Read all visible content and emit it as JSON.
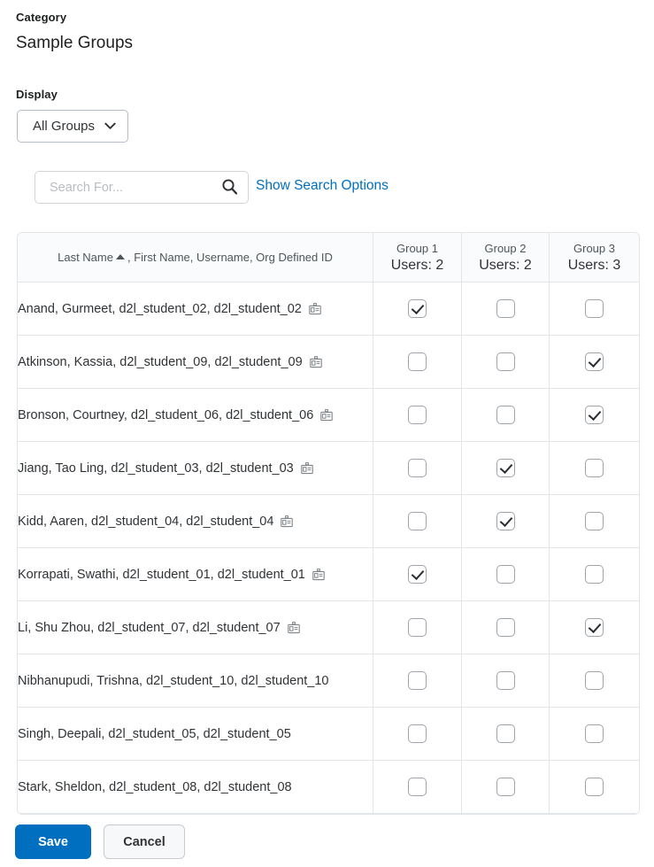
{
  "form": {
    "category_label": "Category",
    "category_value": "Sample Groups",
    "display_label": "Display",
    "display_selected": "All Groups"
  },
  "search": {
    "placeholder": "Search For...",
    "value": "",
    "search_icon": "search-icon",
    "show_options_link": "Show Search Options"
  },
  "table": {
    "name_column": {
      "sort_field": "Last Name",
      "sort_direction": "ascending",
      "rest": ", First Name, Username, Org Defined ID"
    },
    "groups": [
      {
        "name": "Group 1",
        "users": "Users: 2"
      },
      {
        "name": "Group 2",
        "users": "Users: 2"
      },
      {
        "name": "Group 3",
        "users": "Users: 3"
      }
    ],
    "rows": [
      {
        "label": "Anand, Gurmeet, d2l_student_02, d2l_student_02",
        "badge": true,
        "checks": [
          true,
          false,
          false
        ]
      },
      {
        "label": "Atkinson, Kassia, d2l_student_09, d2l_student_09",
        "badge": true,
        "checks": [
          false,
          false,
          true
        ]
      },
      {
        "label": "Bronson, Courtney, d2l_student_06, d2l_student_06",
        "badge": true,
        "checks": [
          false,
          false,
          true
        ]
      },
      {
        "label": "Jiang, Tao Ling, d2l_student_03, d2l_student_03",
        "badge": true,
        "checks": [
          false,
          true,
          false
        ]
      },
      {
        "label": "Kidd, Aaren, d2l_student_04, d2l_student_04",
        "badge": true,
        "checks": [
          false,
          true,
          false
        ]
      },
      {
        "label": "Korrapati, Swathi, d2l_student_01, d2l_student_01",
        "badge": true,
        "checks": [
          true,
          false,
          false
        ]
      },
      {
        "label": "Li, Shu Zhou, d2l_student_07, d2l_student_07",
        "badge": true,
        "checks": [
          false,
          false,
          true
        ]
      },
      {
        "label": "Nibhanupudi, Trishna, d2l_student_10, d2l_student_10",
        "badge": false,
        "checks": [
          false,
          false,
          false
        ]
      },
      {
        "label": "Singh, Deepali, d2l_student_05, d2l_student_05",
        "badge": false,
        "checks": [
          false,
          false,
          false
        ]
      },
      {
        "label": "Stark, Sheldon, d2l_student_08, d2l_student_08",
        "badge": false,
        "checks": [
          false,
          false,
          false
        ]
      }
    ]
  },
  "footer": {
    "save_label": "Save",
    "cancel_label": "Cancel"
  },
  "colors": {
    "accent": "#006fbf",
    "link": "#006fbf",
    "border": "#e3e6e8",
    "header_bg": "#fafbfc",
    "text": "#303336"
  }
}
